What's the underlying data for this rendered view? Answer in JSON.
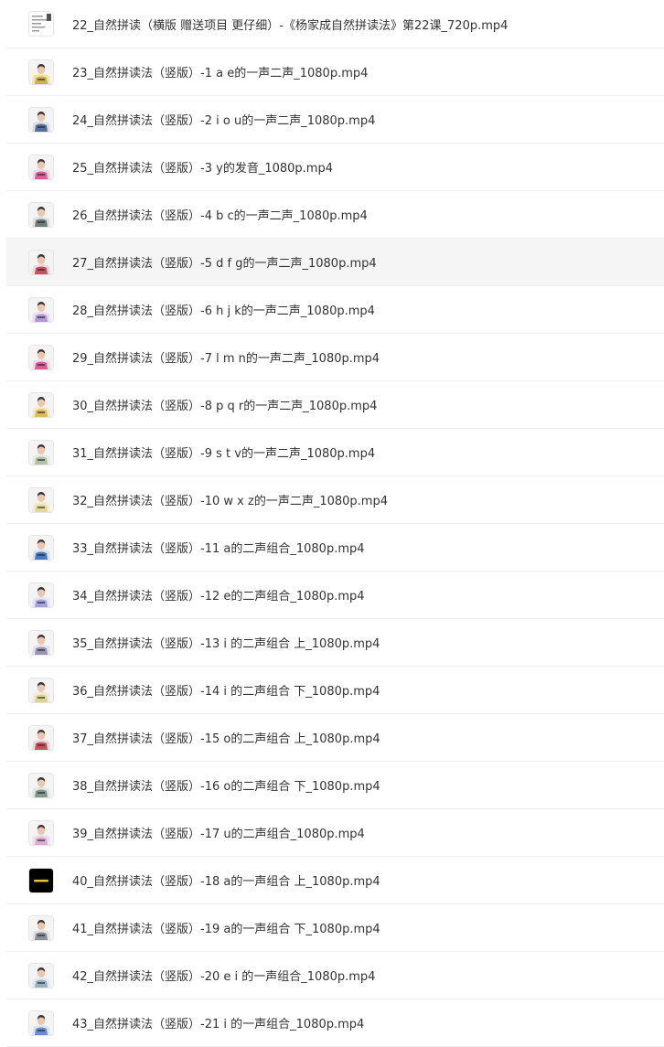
{
  "files": [
    {
      "name": "22_自然拼读（横版 赠送项目 更仔细）-《杨家成自然拼读法》第22课_720p.mp4",
      "thumb": "doc",
      "bg": "#ffffff",
      "fg": "#555555"
    },
    {
      "name": "23_自然拼读法（竖版）-1 a e的一声二声_1080p.mp4",
      "thumb": "person",
      "bg": "#f0e6a8",
      "fg": "#c9a43a"
    },
    {
      "name": "24_自然拼读法（竖版）-2 i o u的一声二声_1080p.mp4",
      "thumb": "person",
      "bg": "#d9dde8",
      "fg": "#3d5a8a"
    },
    {
      "name": "25_自然拼读法（竖版）-3 y的发音_1080p.mp4",
      "thumb": "person",
      "bg": "#f0d8e4",
      "fg": "#d64a8a"
    },
    {
      "name": "26_自然拼读法（竖版）-4 b c的一声二声_1080p.mp4",
      "thumb": "person",
      "bg": "#dfe2e0",
      "fg": "#5a6b66"
    },
    {
      "name": "27_自然拼读法（竖版）-5 d f g的一声二声_1080p.mp4",
      "thumb": "person",
      "bg": "#f0dadc",
      "fg": "#c2374a"
    },
    {
      "name": "28_自然拼读法（竖版）-6 h j k的一声二声_1080p.mp4",
      "thumb": "person",
      "bg": "#e8def0",
      "fg": "#a88ad0"
    },
    {
      "name": "29_自然拼读法（竖版）-7 l m n的一声二声_1080p.mp4",
      "thumb": "person",
      "bg": "#f2dce6",
      "fg": "#d4457e"
    },
    {
      "name": "30_自然拼读法（竖版）-8 p q r的一声二声_1080p.mp4",
      "thumb": "person",
      "bg": "#f3e8c8",
      "fg": "#d8b050"
    },
    {
      "name": "31_自然拼读法（竖版）-9 s t v的一声二声_1080p.mp4",
      "thumb": "person",
      "bg": "#e6ebe2",
      "fg": "#a9b89a"
    },
    {
      "name": "32_自然拼读法（竖版）-10 w x z的一声二声_1080p.mp4",
      "thumb": "person",
      "bg": "#f2ecd2",
      "fg": "#e2d28a"
    },
    {
      "name": "33_自然拼读法（竖版）-11 a的二声组合_1080p.mp4",
      "thumb": "person",
      "bg": "#d8e2f2",
      "fg": "#2f64b8"
    },
    {
      "name": "34_自然拼读法（竖版）-12 e的二声组合_1080p.mp4",
      "thumb": "person",
      "bg": "#e6e4f2",
      "fg": "#9a96d8"
    },
    {
      "name": "35_自然拼读法（竖版）-13 i 的二声组合 上_1080p.mp4",
      "thumb": "person",
      "bg": "#e4e2ec",
      "fg": "#8a86a8"
    },
    {
      "name": "36_自然拼读法（竖版）-14 i 的二声组合 下_1080p.mp4",
      "thumb": "person",
      "bg": "#efecd8",
      "fg": "#d8cf88"
    },
    {
      "name": "37_自然拼读法（竖版）-15 o的二声组合 上_1080p.mp4",
      "thumb": "person",
      "bg": "#f0d8da",
      "fg": "#c23a48"
    },
    {
      "name": "38_自然拼读法（竖版）-16 o的二声组合 下_1080p.mp4",
      "thumb": "person",
      "bg": "#e0e6e2",
      "fg": "#6e8a7c"
    },
    {
      "name": "39_自然拼读法（竖版）-17 u的二声组合_1080p.mp4",
      "thumb": "person",
      "bg": "#f0e0ee",
      "fg": "#d8a0d0"
    },
    {
      "name": "40_自然拼读法（竖版）-18 a的一声组合 上_1080p.mp4",
      "thumb": "dark",
      "bg": "#000000",
      "fg": "#e8c040"
    },
    {
      "name": "41_自然拼读法（竖版）-19 a的一声组合 下_1080p.mp4",
      "thumb": "person",
      "bg": "#e2e4e6",
      "fg": "#7a8086"
    },
    {
      "name": "42_自然拼读法（竖版）-20 e i 的一声组合_1080p.mp4",
      "thumb": "person",
      "bg": "#e2eaee",
      "fg": "#8aa8b8"
    },
    {
      "name": "43_自然拼读法（竖版）-21 i 的一声组合_1080p.mp4",
      "thumb": "person",
      "bg": "#dde4f2",
      "fg": "#5a7ac8"
    }
  ],
  "highlighted_index": 5
}
